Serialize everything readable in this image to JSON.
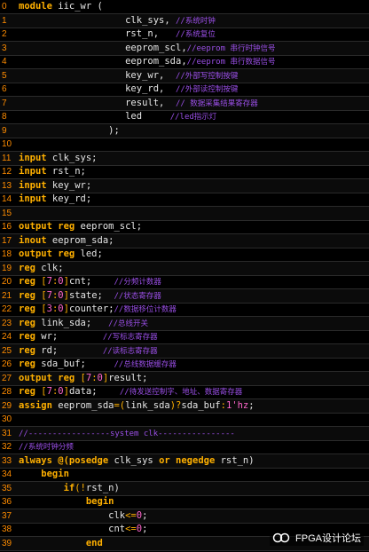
{
  "editor": {
    "lines": [
      {
        "n": "0",
        "t": [
          [
            "kw",
            "module"
          ],
          [
            "tx",
            " iic_wr ("
          ]
        ]
      },
      {
        "n": "1",
        "t": [
          [
            "tx",
            "                   clk_sys, "
          ],
          [
            "cm",
            "//"
          ],
          [
            "ccm",
            "系统时钟"
          ]
        ]
      },
      {
        "n": "2",
        "t": [
          [
            "tx",
            "                   rst_n,   "
          ],
          [
            "cm",
            "//"
          ],
          [
            "ccm",
            "系统复位"
          ]
        ]
      },
      {
        "n": "3",
        "t": [
          [
            "tx",
            "                   eeprom_scl,"
          ],
          [
            "cm",
            "//eeprom "
          ],
          [
            "ccm",
            "串行时钟信号"
          ]
        ]
      },
      {
        "n": "4",
        "t": [
          [
            "tx",
            "                   eeprom_sda,"
          ],
          [
            "cm",
            "//eeprom "
          ],
          [
            "ccm",
            "串行数据信号"
          ]
        ]
      },
      {
        "n": "5",
        "t": [
          [
            "tx",
            "                   key_wr,  "
          ],
          [
            "cm",
            "//"
          ],
          [
            "ccm",
            "外部写控制按键"
          ]
        ]
      },
      {
        "n": "6",
        "t": [
          [
            "tx",
            "                   key_rd,  "
          ],
          [
            "cm",
            "//"
          ],
          [
            "ccm",
            "外部读控制按键"
          ]
        ]
      },
      {
        "n": "7",
        "t": [
          [
            "tx",
            "                   result,  "
          ],
          [
            "cm",
            "// "
          ],
          [
            "ccm",
            "数据采集结果寄存器"
          ]
        ]
      },
      {
        "n": "8",
        "t": [
          [
            "tx",
            "                   led     "
          ],
          [
            "cm",
            "//led"
          ],
          [
            "ccm",
            "指示灯"
          ]
        ]
      },
      {
        "n": "9",
        "t": [
          [
            "tx",
            "                );"
          ]
        ]
      },
      {
        "n": "10",
        "t": []
      },
      {
        "n": "11",
        "t": [
          [
            "kw",
            "input"
          ],
          [
            "tx",
            " clk_sys;"
          ]
        ]
      },
      {
        "n": "12",
        "t": [
          [
            "kw",
            "input"
          ],
          [
            "tx",
            " rst_n;"
          ]
        ]
      },
      {
        "n": "13",
        "t": [
          [
            "kw",
            "input"
          ],
          [
            "tx",
            " key_wr;"
          ]
        ]
      },
      {
        "n": "14",
        "t": [
          [
            "kw",
            "input"
          ],
          [
            "tx",
            " key_rd;"
          ]
        ]
      },
      {
        "n": "15",
        "t": []
      },
      {
        "n": "16",
        "t": [
          [
            "kw",
            "output reg"
          ],
          [
            "tx",
            " eeprom_scl;"
          ]
        ]
      },
      {
        "n": "17",
        "t": [
          [
            "kw",
            "inout"
          ],
          [
            "tx",
            " eeprom_sda;"
          ]
        ]
      },
      {
        "n": "18",
        "t": [
          [
            "kw",
            "output reg"
          ],
          [
            "tx",
            " led;"
          ]
        ]
      },
      {
        "n": "19",
        "t": [
          [
            "kw",
            "reg"
          ],
          [
            "tx",
            " clk;"
          ]
        ]
      },
      {
        "n": "20",
        "t": [
          [
            "kw",
            "reg"
          ],
          [
            "tx",
            " "
          ],
          [
            "op",
            "["
          ],
          [
            "num",
            "7"
          ],
          [
            "op",
            ":"
          ],
          [
            "num",
            "0"
          ],
          [
            "op",
            "]"
          ],
          [
            "tx",
            "cnt;    "
          ],
          [
            "cm",
            "//"
          ],
          [
            "ccm",
            "分频计数器"
          ]
        ]
      },
      {
        "n": "21",
        "t": [
          [
            "kw",
            "reg"
          ],
          [
            "tx",
            " "
          ],
          [
            "op",
            "["
          ],
          [
            "num",
            "7"
          ],
          [
            "op",
            ":"
          ],
          [
            "num",
            "0"
          ],
          [
            "op",
            "]"
          ],
          [
            "tx",
            "state;  "
          ],
          [
            "cm",
            "//"
          ],
          [
            "ccm",
            "状态寄存器"
          ]
        ]
      },
      {
        "n": "22",
        "t": [
          [
            "kw",
            "reg"
          ],
          [
            "tx",
            " "
          ],
          [
            "op",
            "["
          ],
          [
            "num",
            "3"
          ],
          [
            "op",
            ":"
          ],
          [
            "num",
            "0"
          ],
          [
            "op",
            "]"
          ],
          [
            "tx",
            "counter;"
          ],
          [
            "cm",
            "//"
          ],
          [
            "ccm",
            "数据移位计数器"
          ]
        ]
      },
      {
        "n": "23",
        "t": [
          [
            "kw",
            "reg"
          ],
          [
            "tx",
            " link_sda;   "
          ],
          [
            "cm",
            "//"
          ],
          [
            "ccm",
            "总线开关"
          ]
        ]
      },
      {
        "n": "24",
        "t": [
          [
            "kw",
            "reg"
          ],
          [
            "tx",
            " wr;        "
          ],
          [
            "cm",
            "//"
          ],
          [
            "ccm",
            "写标志寄存器"
          ]
        ]
      },
      {
        "n": "25",
        "t": [
          [
            "kw",
            "reg"
          ],
          [
            "tx",
            " rd;        "
          ],
          [
            "cm",
            "//"
          ],
          [
            "ccm",
            "读标志寄存器"
          ]
        ]
      },
      {
        "n": "26",
        "t": [
          [
            "kw",
            "reg"
          ],
          [
            "tx",
            " sda_buf;     "
          ],
          [
            "cm",
            "//"
          ],
          [
            "ccm",
            "总线数据缓存器"
          ]
        ]
      },
      {
        "n": "27",
        "t": [
          [
            "kw",
            "output reg"
          ],
          [
            "tx",
            " "
          ],
          [
            "op",
            "["
          ],
          [
            "num",
            "7"
          ],
          [
            "op",
            ":"
          ],
          [
            "num",
            "0"
          ],
          [
            "op",
            "]"
          ],
          [
            "tx",
            "result;"
          ]
        ]
      },
      {
        "n": "28",
        "t": [
          [
            "kw",
            "reg"
          ],
          [
            "tx",
            " "
          ],
          [
            "op",
            "["
          ],
          [
            "num",
            "7"
          ],
          [
            "op",
            ":"
          ],
          [
            "num",
            "0"
          ],
          [
            "op",
            "]"
          ],
          [
            "tx",
            "data;    "
          ],
          [
            "cm",
            "//"
          ],
          [
            "ccm",
            "待发送控制字、地址、数据寄存器"
          ]
        ]
      },
      {
        "n": "29",
        "t": [
          [
            "kw",
            "assign"
          ],
          [
            "tx",
            " eeprom_sda"
          ],
          [
            "op",
            "=("
          ],
          [
            "tx",
            "link_sda"
          ],
          [
            "op",
            ")?"
          ],
          [
            "tx",
            "sda_buf"
          ],
          [
            "op",
            ":"
          ],
          [
            "num",
            "1'hz"
          ],
          [
            "tx",
            ";"
          ]
        ]
      },
      {
        "n": "30",
        "t": []
      },
      {
        "n": "31",
        "t": [
          [
            "cm",
            "//-----------------system clk----------------"
          ]
        ]
      },
      {
        "n": "32",
        "t": [
          [
            "cm",
            "//"
          ],
          [
            "ccm",
            "系统时钟分频"
          ]
        ]
      },
      {
        "n": "33",
        "t": [
          [
            "kw",
            "always @(posedge"
          ],
          [
            "tx",
            " clk_sys "
          ],
          [
            "kw",
            "or negedge"
          ],
          [
            "tx",
            " rst_n)"
          ]
        ]
      },
      {
        "n": "34",
        "t": [
          [
            "kw",
            "    begin"
          ]
        ]
      },
      {
        "n": "35",
        "t": [
          [
            "kw",
            "        if"
          ],
          [
            "op",
            "(!"
          ],
          [
            "tx",
            "rst_n)"
          ]
        ]
      },
      {
        "n": "36",
        "t": [
          [
            "kw",
            "            begin"
          ]
        ]
      },
      {
        "n": "37",
        "t": [
          [
            "tx",
            "                clk"
          ],
          [
            "op",
            "<="
          ],
          [
            "num",
            "0"
          ],
          [
            "tx",
            ";"
          ]
        ]
      },
      {
        "n": "38",
        "t": [
          [
            "tx",
            "                cnt"
          ],
          [
            "op",
            "<="
          ],
          [
            "num",
            "0"
          ],
          [
            "tx",
            ";"
          ]
        ]
      },
      {
        "n": "39",
        "t": [
          [
            "kw",
            "            end"
          ]
        ]
      }
    ]
  },
  "watermark": {
    "text": "FPGA设计论坛",
    "icon": "wechat-channel-icon"
  }
}
